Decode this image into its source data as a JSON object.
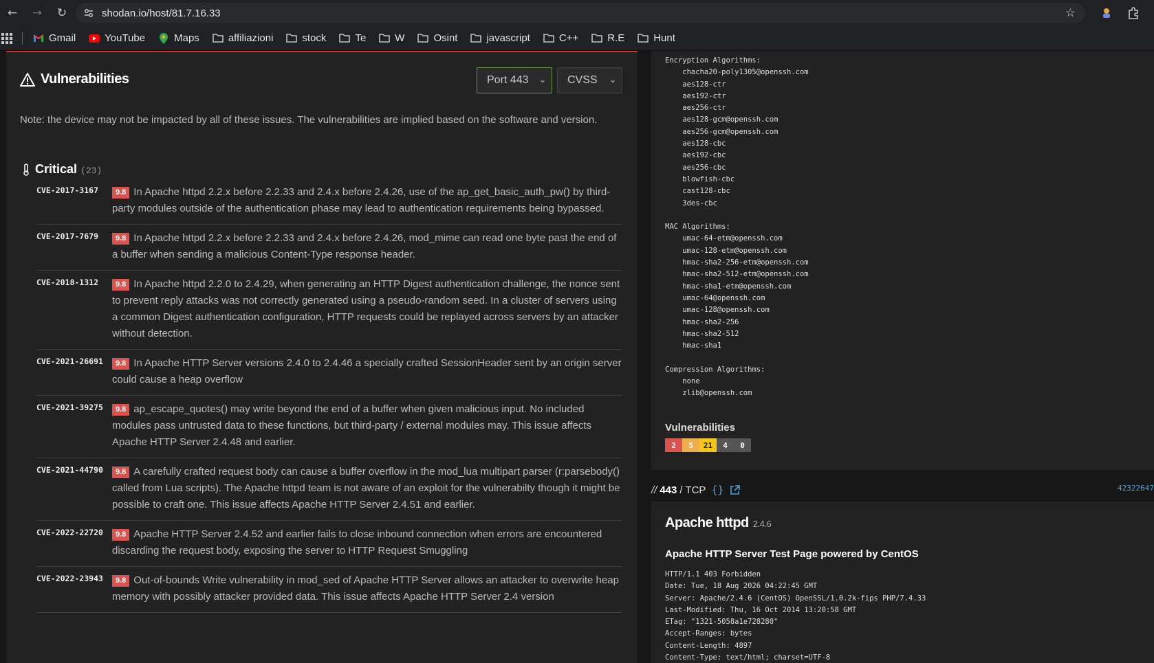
{
  "browser": {
    "url": "shodan.io/host/81.7.16.33",
    "bookmarks": [
      {
        "label": "Gmail",
        "icon": "gmail-icon"
      },
      {
        "label": "YouTube",
        "icon": "youtube-icon"
      },
      {
        "label": "Maps",
        "icon": "maps-icon"
      },
      {
        "label": "affiliazioni",
        "icon": "folder-icon"
      },
      {
        "label": "stock",
        "icon": "folder-icon"
      },
      {
        "label": "Te",
        "icon": "folder-icon"
      },
      {
        "label": "W",
        "icon": "folder-icon"
      },
      {
        "label": "Osint",
        "icon": "folder-icon"
      },
      {
        "label": "javascript",
        "icon": "folder-icon"
      },
      {
        "label": "C++",
        "icon": "folder-icon"
      },
      {
        "label": "R.E",
        "icon": "folder-icon"
      },
      {
        "label": "Hunt",
        "icon": "folder-icon"
      }
    ]
  },
  "vulnerabilities": {
    "title": "Vulnerabilities",
    "port_select": "Port 443",
    "sort_select": "CVSS",
    "note": "Note: the device may not be impacted by all of these issues. The vulnerabilities are implied based on the software and version.",
    "critical_label": "Critical",
    "critical_count": "(23)",
    "items": [
      {
        "id": "CVE-2017-3167",
        "score": "9.8",
        "text": "In Apache httpd 2.2.x before 2.2.33 and 2.4.x before 2.4.26, use of the ap_get_basic_auth_pw() by third-party modules outside of the authentication phase may lead to authentication requirements being bypassed."
      },
      {
        "id": "CVE-2017-7679",
        "score": "9.8",
        "text": "In Apache httpd 2.2.x before 2.2.33 and 2.4.x before 2.4.26, mod_mime can read one byte past the end of a buffer when sending a malicious Content-Type response header."
      },
      {
        "id": "CVE-2018-1312",
        "score": "9.8",
        "text": "In Apache httpd 2.2.0 to 2.4.29, when generating an HTTP Digest authentication challenge, the nonce sent to prevent reply attacks was not correctly generated using a pseudo-random seed. In a cluster of servers using a common Digest authentication configuration, HTTP requests could be replayed across servers by an attacker without detection."
      },
      {
        "id": "CVE-2021-26691",
        "score": "9.8",
        "text": "In Apache HTTP Server versions 2.4.0 to 2.4.46 a specially crafted SessionHeader sent by an origin server could cause a heap overflow"
      },
      {
        "id": "CVE-2021-39275",
        "score": "9.8",
        "text": "ap_escape_quotes() may write beyond the end of a buffer when given malicious input. No included modules pass untrusted data to these functions, but third-party / external modules may. This issue affects Apache HTTP Server 2.4.48 and earlier."
      },
      {
        "id": "CVE-2021-44790",
        "score": "9.8",
        "text": "A carefully crafted request body can cause a buffer overflow in the mod_lua multipart parser (r:parsebody() called from Lua scripts). The Apache httpd team is not aware of an exploit for the vulnerabilty though it might be possible to craft one. This issue affects Apache HTTP Server 2.4.51 and earlier."
      },
      {
        "id": "CVE-2022-22720",
        "score": "9.8",
        "text": "Apache HTTP Server 2.4.52 and earlier fails to close inbound connection when errors are encountered discarding the request body, exposing the server to HTTP Request Smuggling"
      },
      {
        "id": "CVE-2022-23943",
        "score": "9.8",
        "text": "Out-of-bounds Write vulnerability in mod_sed of Apache HTTP Server allows an attacker to overwrite heap memory with possibly attacker provided data. This issue affects Apache HTTP Server 2.4 version"
      }
    ]
  },
  "ssh": {
    "enc_header": "Encryption Algorithms:",
    "enc": [
      "chacha20-poly1305@openssh.com",
      "aes128-ctr",
      "aes192-ctr",
      "aes256-ctr",
      "aes128-gcm@openssh.com",
      "aes256-gcm@openssh.com",
      "aes128-cbc",
      "aes192-cbc",
      "aes256-cbc",
      "blowfish-cbc",
      "cast128-cbc",
      "3des-cbc"
    ],
    "mac_header": "MAC Algorithms:",
    "mac": [
      "umac-64-etm@openssh.com",
      "umac-128-etm@openssh.com",
      "hmac-sha2-256-etm@openssh.com",
      "hmac-sha2-512-etm@openssh.com",
      "hmac-sha1-etm@openssh.com",
      "umac-64@openssh.com",
      "umac-128@openssh.com",
      "hmac-sha2-256",
      "hmac-sha2-512",
      "hmac-sha1"
    ],
    "comp_header": "Compression Algorithms:",
    "comp": [
      "none",
      "zlib@openssh.com"
    ],
    "vuln_title": "Vulnerabilities",
    "vuln_counts": [
      {
        "value": "2",
        "color": "#d9534f"
      },
      {
        "value": "5",
        "color": "#f0ad4e"
      },
      {
        "value": "21",
        "color": "#f5c518"
      },
      {
        "value": "4",
        "color": "#555555"
      },
      {
        "value": "0",
        "color": "#555555"
      }
    ]
  },
  "port443": {
    "slashes": "//",
    "port": "443",
    "proto": "/ TCP",
    "hash": "42322647",
    "product": "Apache httpd",
    "version": "2.4.6",
    "page_title": "Apache HTTP Server Test Page powered by CentOS",
    "http_lines": [
      "HTTP/1.1 403 Forbidden",
      "Date: Tue, 18 Aug 2026 04:22:45 GMT",
      "Server: Apache/2.4.6 (CentOS) OpenSSL/1.0.2k-fips PHP/7.4.33",
      "Last-Modified: Thu, 16 Oct 2014 13:20:58 GMT",
      "ETag: \"1321-5058a1e728280\"",
      "Accept-Ranges: bytes",
      "Content-Length: 4897",
      "Content-Type: text/html; charset=UTF-8"
    ]
  }
}
